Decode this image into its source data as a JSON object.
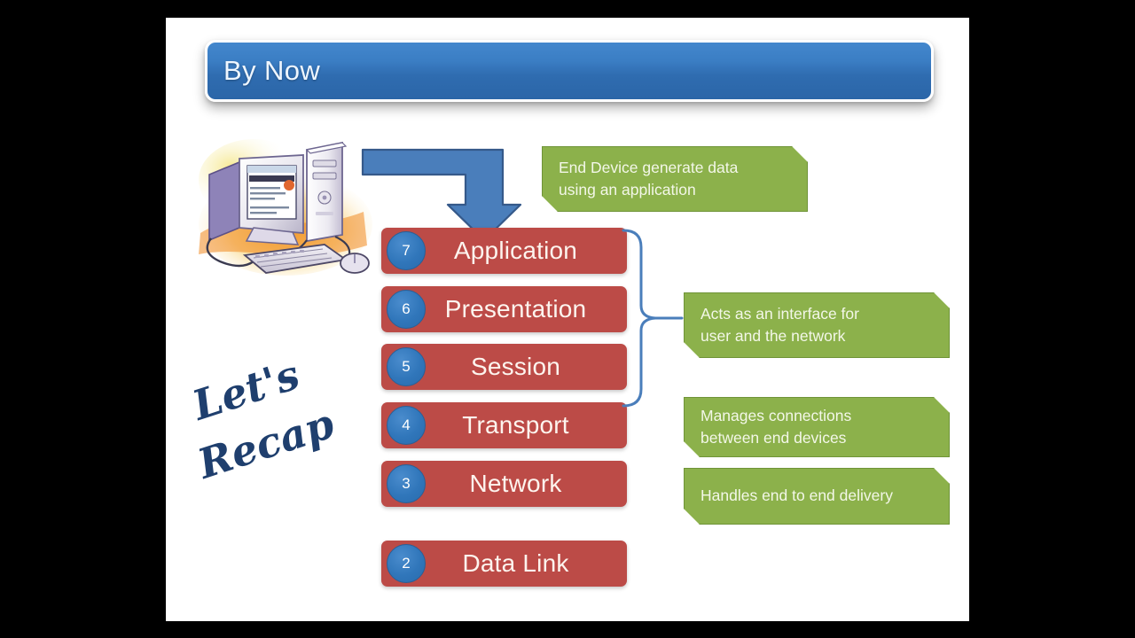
{
  "slide": {
    "title": "By Now",
    "background_color": "#ffffff",
    "stage_background_color": "#000000"
  },
  "colors": {
    "title_bar_blue": "#2f6cb0",
    "layer_red": "#bc4b47",
    "badge_blue": "#3076ba",
    "callout_green": "#8cb14b",
    "callout_green_border": "#6f9438",
    "arrow_blue": "#4a7ebb",
    "arrow_blue_outline": "#35598a",
    "script_text_blue": "#1f3f6e"
  },
  "handwritten_note": {
    "line1": "Let's",
    "line2": "Recap"
  },
  "clipart": {
    "computer": "desktop-computer-clipart"
  },
  "osi_layers": [
    {
      "number": "7",
      "name": "Application"
    },
    {
      "number": "6",
      "name": "Presentation"
    },
    {
      "number": "5",
      "name": "Session"
    },
    {
      "number": "4",
      "name": "Transport"
    },
    {
      "number": "3",
      "name": "Network"
    },
    {
      "number": "2",
      "name": "Data Link"
    }
  ],
  "callouts": {
    "end_device": {
      "line1": "End Device generate data",
      "line2": "using an application"
    },
    "interface": {
      "line1": "Acts as an interface for",
      "line2": "user and the network"
    },
    "manages": {
      "line1": "Manages connections",
      "line2": "between end devices"
    },
    "handles": {
      "line1": "Handles end to end delivery",
      "line2": ""
    }
  }
}
